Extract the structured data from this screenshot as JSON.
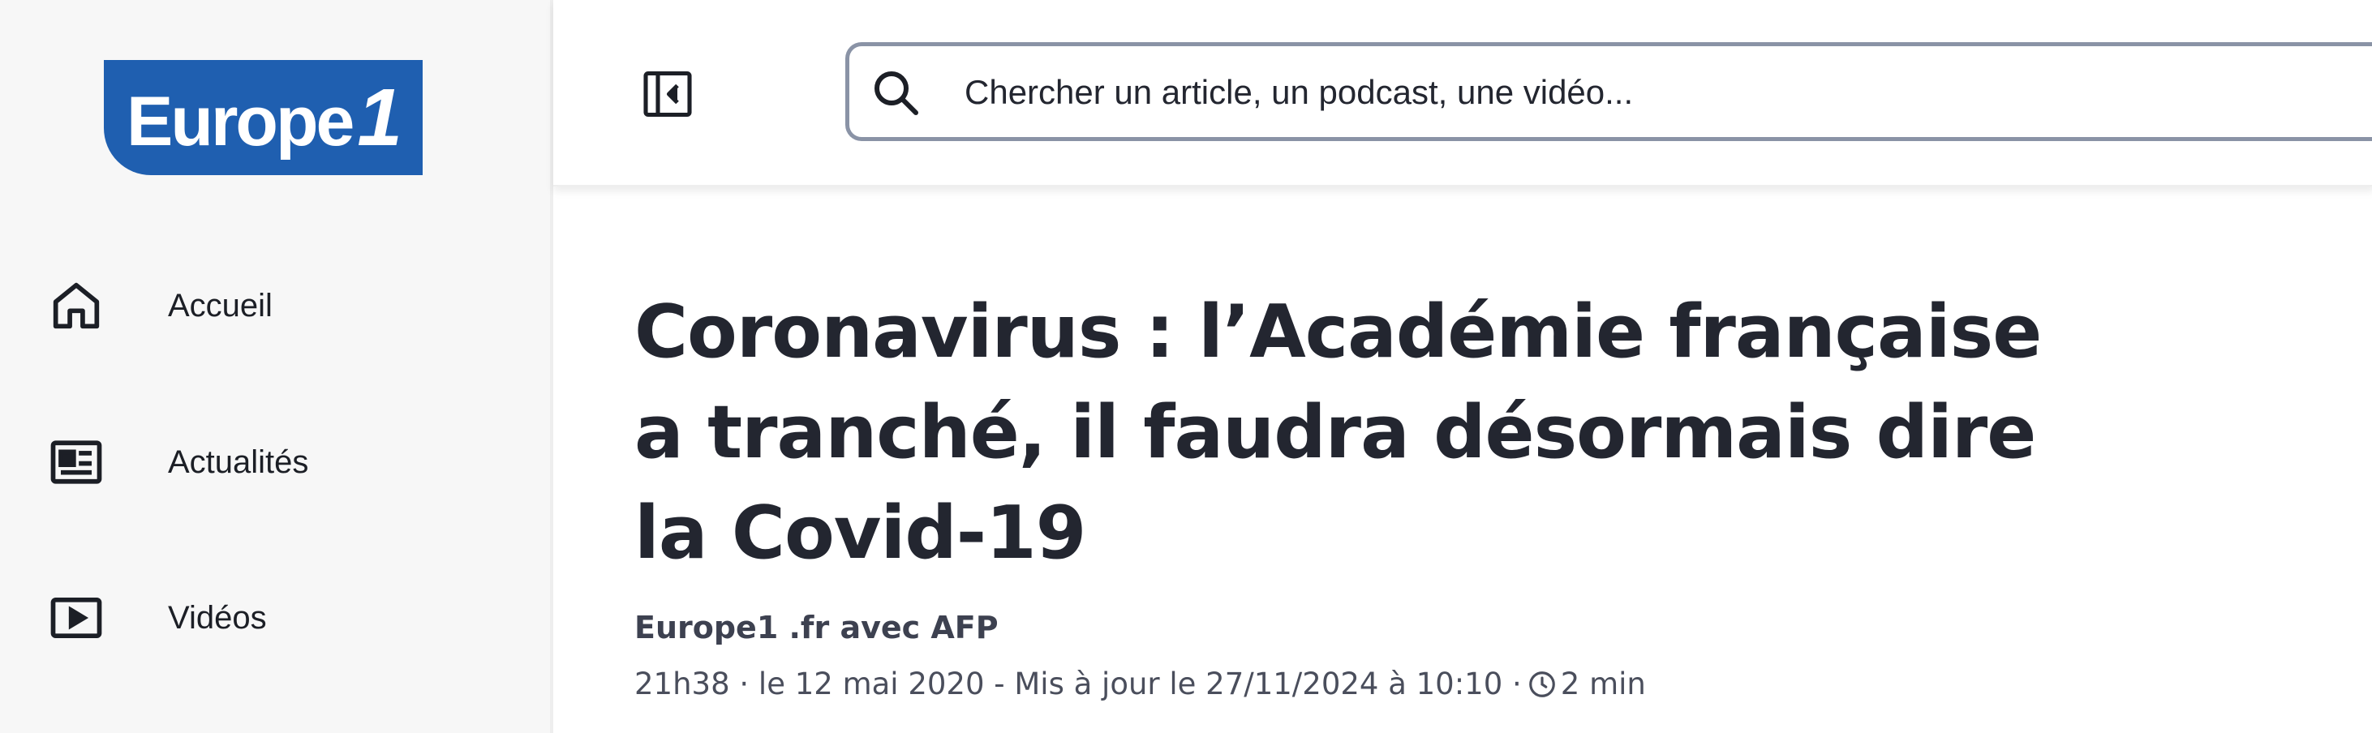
{
  "sidebar": {
    "logo": {
      "text": "Europe",
      "number": "1",
      "brand_color": "#1f5fb0"
    },
    "items": [
      {
        "label": "Accueil",
        "icon": "home-icon"
      },
      {
        "label": "Actualités",
        "icon": "newspaper-icon"
      },
      {
        "label": "Vidéos",
        "icon": "play-icon"
      }
    ]
  },
  "header": {
    "toggle_icon": "sidebar-toggle-icon",
    "search": {
      "icon": "search-icon",
      "placeholder": "Chercher un article, un podcast, une vidéo..."
    }
  },
  "article": {
    "title": "Coronavirus : l’Académie française a tranché, il faudra désormais dire   la Covid-19",
    "byline": "Europe1 .fr avec AFP",
    "meta": {
      "time": "21h38",
      "date": "le 12 mai 2020 - Mis à jour le 27/11/2024 à 10:10",
      "read_time_icon": "clock-icon",
      "read_time": "2 min"
    }
  }
}
